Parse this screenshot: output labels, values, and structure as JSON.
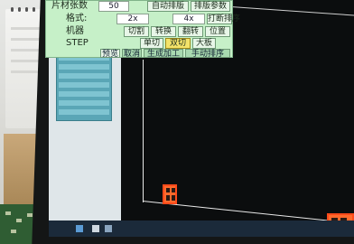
{
  "panel": {
    "row1": {
      "label": "片材张数",
      "value": "50",
      "buttons": [
        "自动排版",
        "排版参数"
      ]
    },
    "row2": {
      "label": "格式:",
      "value": "2x",
      "value2": "4x",
      "button": "打断排序"
    },
    "row3": {
      "label": "机器",
      "buttons": [
        "切割",
        "转换",
        "翻转",
        "位置"
      ]
    },
    "row4": {
      "label": "STEP",
      "buttons": [
        "单切",
        "双切",
        "大板"
      ]
    },
    "tabs": [
      "预览",
      "取消",
      "生成加工",
      "手动排序"
    ]
  },
  "colors": {
    "panel_bg": "#c6f0c8",
    "highlight_yellow": "#f3e36a",
    "part_orange": "#ff6a2c",
    "canvas_bg": "#0b0d0e"
  }
}
